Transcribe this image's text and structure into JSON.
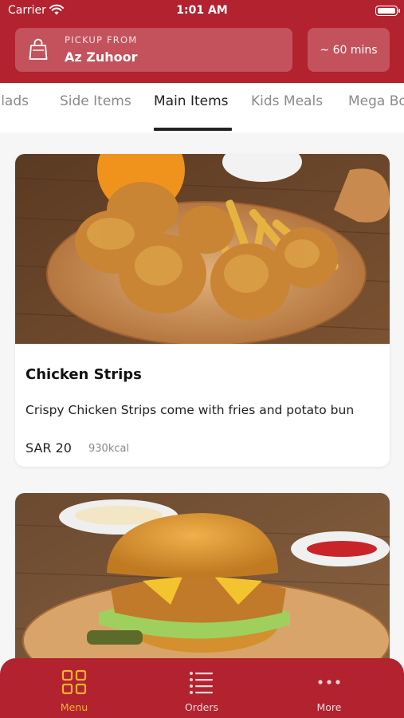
{
  "status_bar": {
    "carrier": "Carrier",
    "time": "1:01 AM"
  },
  "header": {
    "pickup_caption": "PICKUP FROM",
    "pickup_location": "Az Zuhoor",
    "wait_time": "~ 60 mins"
  },
  "tabs": [
    {
      "label": "Salads",
      "active": false
    },
    {
      "label": "Side Items",
      "active": false
    },
    {
      "label": "Main Items",
      "active": true
    },
    {
      "label": "Kids Meals",
      "active": false
    },
    {
      "label": "Mega Box",
      "active": false
    }
  ],
  "products": [
    {
      "title": "Chicken Strips",
      "description": "Crispy Chicken Strips come with fries and potato bun",
      "price": "SAR 20",
      "calories": "930kcal",
      "image": "chicken-strips-photo"
    },
    {
      "title": "",
      "image": "chicken-burger-photo"
    }
  ],
  "bottom_nav": [
    {
      "label": "Menu",
      "icon": "grid-icon",
      "active": true
    },
    {
      "label": "Orders",
      "icon": "list-icon",
      "active": false
    },
    {
      "label": "More",
      "icon": "more-dots-icon",
      "active": false
    }
  ],
  "colors": {
    "brand": "#b3222f",
    "active_nav": "#f2b234"
  }
}
